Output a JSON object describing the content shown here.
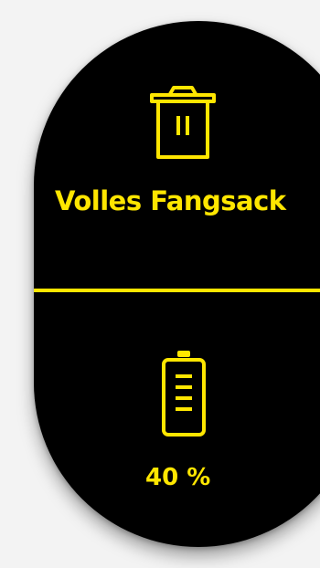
{
  "status": {
    "icon": "trash-full-icon",
    "title": "Volles Fangsack"
  },
  "battery": {
    "icon": "battery-icon",
    "level_text": "40 %",
    "level_percent": 40
  },
  "colors": {
    "accent": "#ffe600",
    "panel": "#000000",
    "background": "#f3f3f3"
  }
}
